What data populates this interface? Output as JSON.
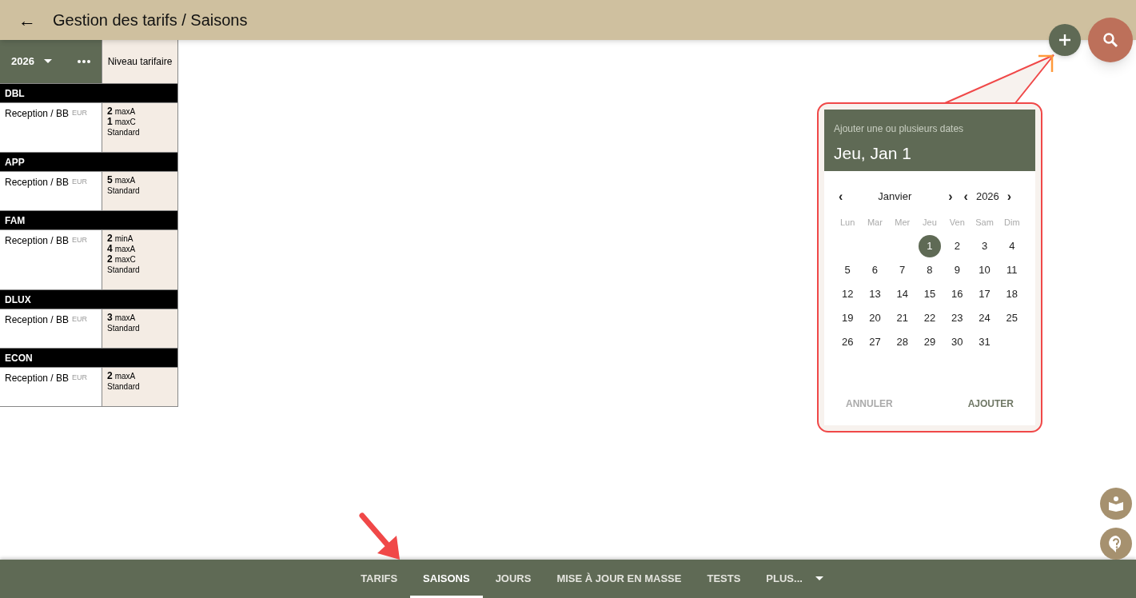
{
  "header": {
    "back": "←",
    "title": "Gestion des tarifs / Saisons"
  },
  "table": {
    "year": "2026",
    "column_header": "Niveau tarifaire",
    "groups": [
      {
        "name": "DBL",
        "rows": [
          {
            "label": "Reception / BB",
            "currency": "EUR",
            "levels": [
              {
                "count": "2",
                "rule": "maxA"
              },
              {
                "count": "1",
                "rule": "maxC"
              }
            ],
            "tariff": "Standard"
          }
        ]
      },
      {
        "name": "APP",
        "rows": [
          {
            "label": "Reception / BB",
            "currency": "EUR",
            "levels": [
              {
                "count": "5",
                "rule": "maxA"
              }
            ],
            "tariff": "Standard"
          }
        ]
      },
      {
        "name": "FAM",
        "rows": [
          {
            "label": "Reception / BB",
            "currency": "EUR",
            "levels": [
              {
                "count": "2",
                "rule": "minA"
              },
              {
                "count": "4",
                "rule": "maxA"
              },
              {
                "count": "2",
                "rule": "maxC"
              }
            ],
            "tariff": "Standard"
          }
        ]
      },
      {
        "name": "DLUX",
        "rows": [
          {
            "label": "Reception / BB",
            "currency": "EUR",
            "levels": [
              {
                "count": "3",
                "rule": "maxA"
              }
            ],
            "tariff": "Standard"
          }
        ]
      },
      {
        "name": "ECON",
        "rows": [
          {
            "label": "Reception / BB",
            "currency": "EUR",
            "levels": [
              {
                "count": "2",
                "rule": "maxA"
              }
            ],
            "tariff": "Standard"
          }
        ]
      }
    ]
  },
  "date_picker": {
    "subtitle": "Ajouter une ou plusieurs dates",
    "selected_date": "Jeu, Jan 1",
    "month_prev": "‹",
    "month": "Janvier",
    "month_next": "›",
    "year_prev": "‹",
    "year": "2026",
    "year_next": "›",
    "weekdays": [
      "Lun",
      "Mar",
      "Mer",
      "Jeu",
      "Ven",
      "Sam",
      "Dim"
    ],
    "weeks": [
      [
        {
          "day": "1",
          "selected": true
        },
        {
          "day": "2",
          "selected": false
        },
        {
          "day": "3",
          "selected": false
        },
        {
          "day": "4",
          "selected": false
        }
      ],
      [
        {
          "day": "5",
          "selected": false
        },
        {
          "day": "6",
          "selected": false
        },
        {
          "day": "7",
          "selected": false
        },
        {
          "day": "8",
          "selected": false
        },
        {
          "day": "9",
          "selected": false
        },
        {
          "day": "10",
          "selected": false
        },
        {
          "day": "11",
          "selected": false
        }
      ],
      [
        {
          "day": "12",
          "selected": false
        },
        {
          "day": "13",
          "selected": false
        },
        {
          "day": "14",
          "selected": false
        },
        {
          "day": "15",
          "selected": false
        },
        {
          "day": "16",
          "selected": false
        },
        {
          "day": "17",
          "selected": false
        },
        {
          "day": "18",
          "selected": false
        }
      ],
      [
        {
          "day": "19",
          "selected": false
        },
        {
          "day": "20",
          "selected": false
        },
        {
          "day": "21",
          "selected": false
        },
        {
          "day": "22",
          "selected": false
        },
        {
          "day": "23",
          "selected": false
        },
        {
          "day": "24",
          "selected": false
        },
        {
          "day": "25",
          "selected": false
        }
      ],
      [
        {
          "day": "26",
          "selected": false
        },
        {
          "day": "27",
          "selected": false
        },
        {
          "day": "28",
          "selected": false
        },
        {
          "day": "29",
          "selected": false
        },
        {
          "day": "30",
          "selected": false
        },
        {
          "day": "31",
          "selected": false
        }
      ]
    ],
    "cancel": "ANNULER",
    "confirm": "AJOUTER"
  },
  "tabs": [
    {
      "label": "TARIFS",
      "selected": false
    },
    {
      "label": "SAISONS",
      "selected": true
    },
    {
      "label": "JOURS",
      "selected": false
    },
    {
      "label": "MISE À JOUR EN MASSE",
      "selected": false
    },
    {
      "label": "TESTS",
      "selected": false
    },
    {
      "label": "PLUS...",
      "selected": false
    }
  ]
}
